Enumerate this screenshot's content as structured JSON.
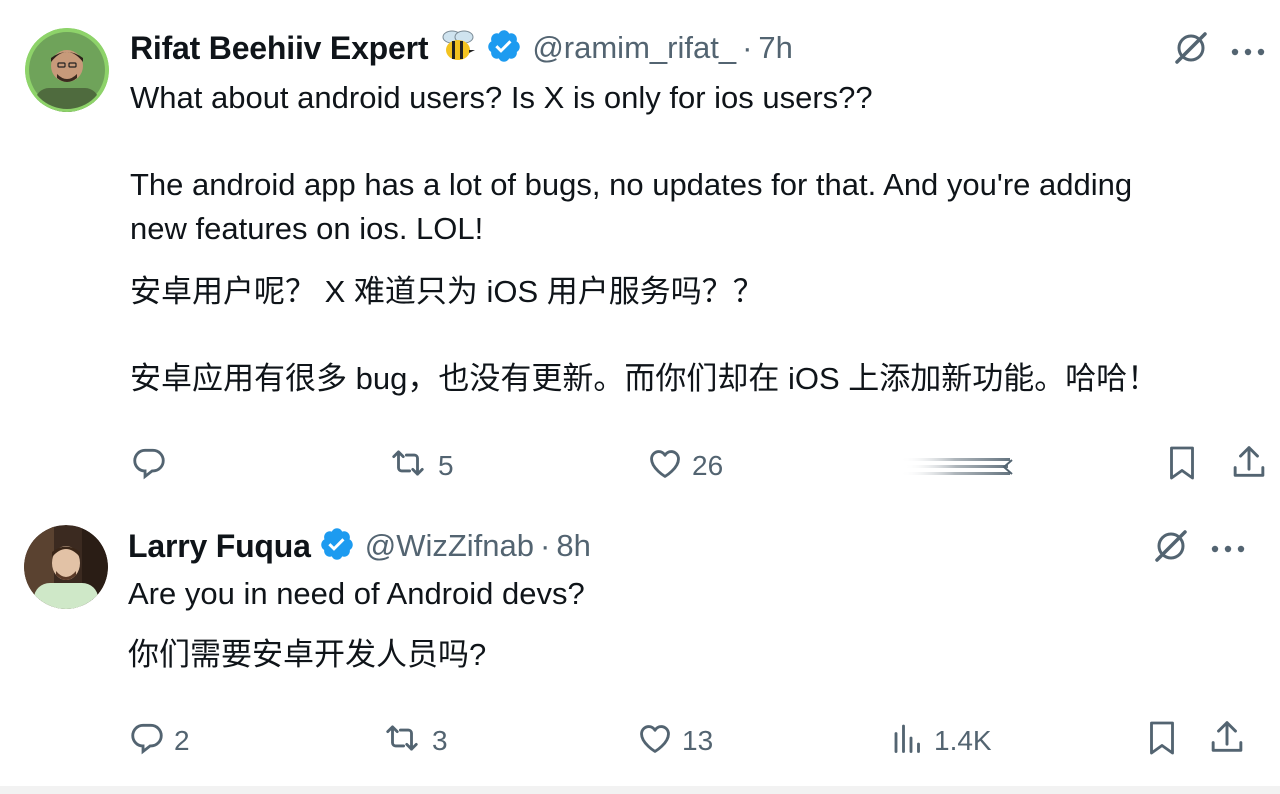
{
  "tweets": [
    {
      "author": {
        "name": "Rifat Beehiiv Expert",
        "emoji": "bee",
        "verified": true,
        "handle": "@ramim_rifat_",
        "separator": "·",
        "time": "7h"
      },
      "lines": [
        "What about android users? Is X is only for ios users??",
        "The android app has a lot of bugs, no updates for that. And you're adding",
        "new features on ios. LOL!",
        "安卓用户呢？ X 难道只为 iOS 用户服务吗？？",
        "安卓应用有很多 bug，也没有更新。而你们却在 iOS 上添加新功能。哈哈！"
      ],
      "actions": {
        "reply": "",
        "repost": "5",
        "like": "26",
        "views": ""
      },
      "icons": [
        "reply-icon",
        "repost-icon",
        "like-icon",
        "bookmark-icon",
        "share-icon",
        "grok-icon",
        "more-icon"
      ]
    },
    {
      "author": {
        "name": "Larry Fuqua",
        "verified": true,
        "handle": "@WizZifnab",
        "separator": "·",
        "time": "8h"
      },
      "lines": [
        "Are you in need of Android devs?",
        "你们需要安卓开发人员吗?"
      ],
      "actions": {
        "reply": "2",
        "repost": "3",
        "like": "13",
        "views": "1.4K"
      },
      "icons": [
        "reply-icon",
        "repost-icon",
        "like-icon",
        "views-icon",
        "bookmark-icon",
        "share-icon",
        "grok-icon",
        "more-icon"
      ]
    }
  ],
  "colors": {
    "text": "#0f1419",
    "secondary": "#536471",
    "verified": "#1d9bf0",
    "avatar_ring": "#8ed36a"
  }
}
